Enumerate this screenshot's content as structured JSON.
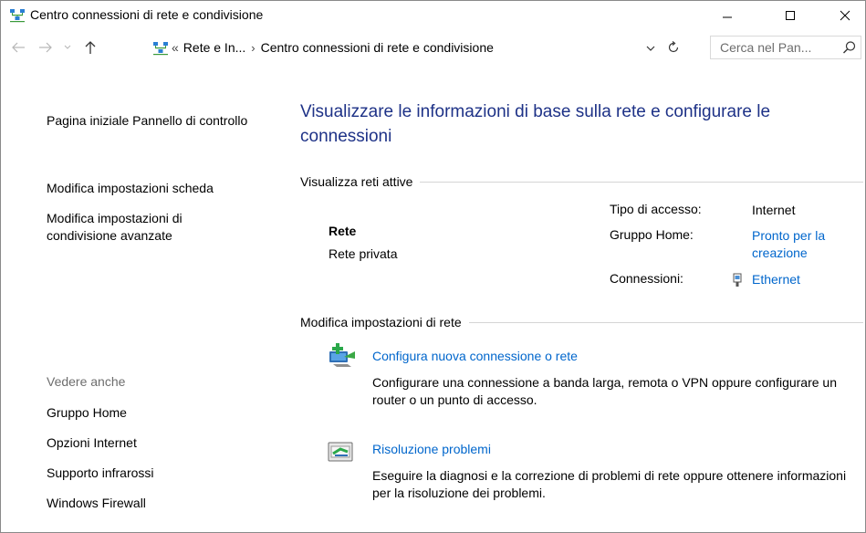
{
  "window": {
    "title": "Centro connessioni di rete e condivisione"
  },
  "address": {
    "ellipsis": "«",
    "crumbs": [
      "Rete e In...",
      "Centro connessioni di rete e condivisione"
    ],
    "search_placeholder": "Cerca nel Pan..."
  },
  "sidebar": {
    "links": [
      "Pagina iniziale Pannello di controllo",
      "Modifica impostazioni scheda",
      "Modifica impostazioni di condivisione avanzate"
    ],
    "see_also_heading": "Vedere anche",
    "see_also": [
      "Gruppo Home",
      "Opzioni Internet",
      "Supporto infrarossi",
      "Windows Firewall"
    ]
  },
  "main": {
    "title": "Visualizzare le informazioni di base sulla rete e configurare le connessioni",
    "active_networks": {
      "heading": "Visualizza reti attive",
      "network_name": "Rete",
      "network_type": "Rete privata",
      "access_type_label": "Tipo di accesso:",
      "access_type_value": "Internet",
      "homegroup_label": "Gruppo Home:",
      "homegroup_value": "Pronto per la creazione",
      "connections_label": "Connessioni:",
      "connections_value": "Ethernet"
    },
    "change_settings": {
      "heading": "Modifica impostazioni di rete",
      "tasks": [
        {
          "link": "Configura nuova connessione o rete",
          "description": "Configurare una connessione a banda larga, remota o VPN oppure configurare un router o un punto di accesso.",
          "icon": "new-connection-icon"
        },
        {
          "link": "Risoluzione problemi",
          "description": "Eseguire la diagnosi e la correzione di problemi di rete oppure ottenere informazioni per la risoluzione dei problemi.",
          "icon": "troubleshoot-icon"
        }
      ]
    }
  },
  "colors": {
    "title_blue": "#1e3287",
    "link_blue": "#0066cc",
    "muted_gray": "#6d6d6d"
  }
}
